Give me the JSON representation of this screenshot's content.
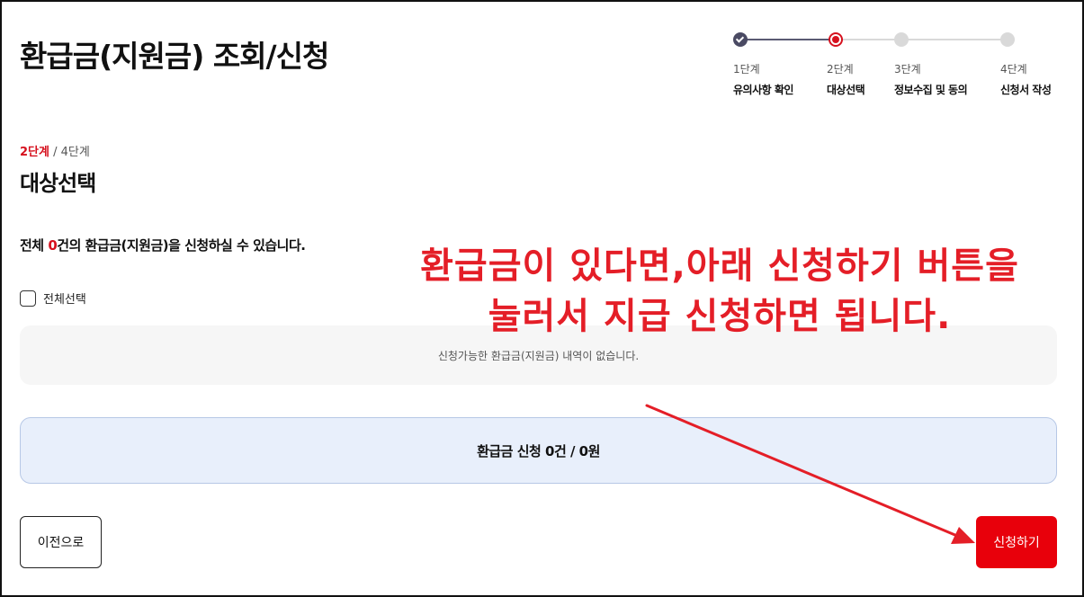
{
  "page": {
    "title": "환급금(지원금) 조회/신청"
  },
  "stepper": {
    "steps": [
      {
        "num": "1단계",
        "name": "유의사항 확인",
        "state": "done"
      },
      {
        "num": "2단계",
        "name": "대상선택",
        "state": "current"
      },
      {
        "num": "3단계",
        "name": "정보수집 및 동의",
        "state": "todo"
      },
      {
        "num": "4단계",
        "name": "신청서 작성",
        "state": "todo"
      }
    ]
  },
  "section": {
    "step_current": "2단계",
    "step_total": " / 4단계",
    "title": "대상선택"
  },
  "summary": {
    "prefix": "전체 ",
    "count": "0",
    "suffix": "건의 환급금(지원금)을 신청하실 수 있습니다."
  },
  "select_all": {
    "label": "전체선택",
    "checked": false
  },
  "empty_message": "신청가능한 환급금(지원금) 내역이 없습니다.",
  "total": {
    "text": "환급금 신청 0건 / 0원"
  },
  "buttons": {
    "prev": "이전으로",
    "apply": "신청하기"
  },
  "annotation": {
    "line1": "환급금이 있다면,아래 신청하기 버튼을",
    "line2": "눌러서 지급 신청하면 됩니다.",
    "color": "#e41e27"
  },
  "colors": {
    "accent_red": "#d6111e",
    "apply_button": "#e8000b",
    "total_box_bg": "#e8effb"
  }
}
